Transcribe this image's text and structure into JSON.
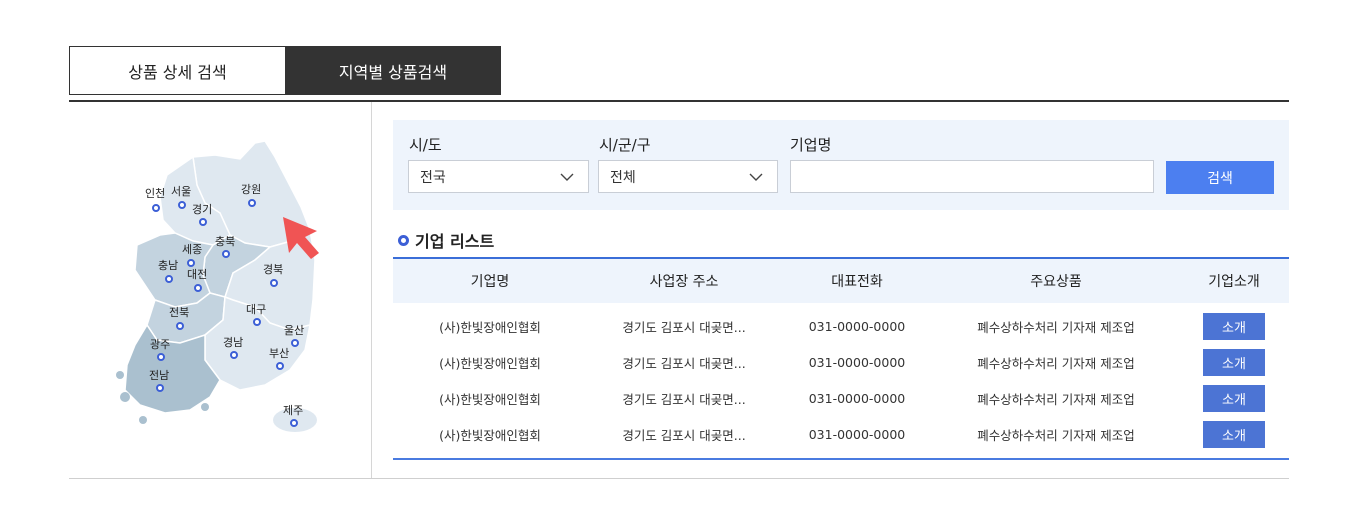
{
  "tabs": [
    {
      "label": "상품 상세 검색",
      "active": false
    },
    {
      "label": "지역별 상품검색",
      "active": true
    }
  ],
  "map": {
    "regions": [
      {
        "label": "인천"
      },
      {
        "label": "서울"
      },
      {
        "label": "강원"
      },
      {
        "label": "경기"
      },
      {
        "label": "세종"
      },
      {
        "label": "충북"
      },
      {
        "label": "충남"
      },
      {
        "label": "대전"
      },
      {
        "label": "경북"
      },
      {
        "label": "전북"
      },
      {
        "label": "대구"
      },
      {
        "label": "울산"
      },
      {
        "label": "광주"
      },
      {
        "label": "경남"
      },
      {
        "label": "부산"
      },
      {
        "label": "전남"
      },
      {
        "label": "제주"
      }
    ],
    "colors": {
      "light": "#dfe8f0",
      "mid": "#c3d3df",
      "dark": "#aac0cf",
      "dot": "#3c5fd6",
      "pointer": "#f05454"
    }
  },
  "search": {
    "province_label": "시/도",
    "province_value": "전국",
    "city_label": "시/군/구",
    "city_value": "전체",
    "company_label": "기업명",
    "company_value": "",
    "company_placeholder": "",
    "search_button": "검색"
  },
  "list": {
    "title": "기업 리스트",
    "columns": [
      "기업명",
      "사업장 주소",
      "대표전화",
      "주요상품",
      "기업소개"
    ],
    "rows": [
      {
        "name": "(사)한빛장애인협회",
        "address": "경기도 김포시 대곶면...",
        "phone": "031-0000-0000",
        "product": "폐수상하수처리 기자재 제조업",
        "button": "소개"
      },
      {
        "name": "(사)한빛장애인협회",
        "address": "경기도 김포시 대곶면...",
        "phone": "031-0000-0000",
        "product": "폐수상하수처리 기자재 제조업",
        "button": "소개"
      },
      {
        "name": "(사)한빛장애인협회",
        "address": "경기도 김포시 대곶면...",
        "phone": "031-0000-0000",
        "product": "폐수상하수처리 기자재 제조업",
        "button": "소개"
      },
      {
        "name": "(사)한빛장애인협회",
        "address": "경기도 김포시 대곶면...",
        "phone": "031-0000-0000",
        "product": "폐수상하수처리 기자재 제조업",
        "button": "소개"
      }
    ]
  },
  "accent_color": "#4c7ff0"
}
